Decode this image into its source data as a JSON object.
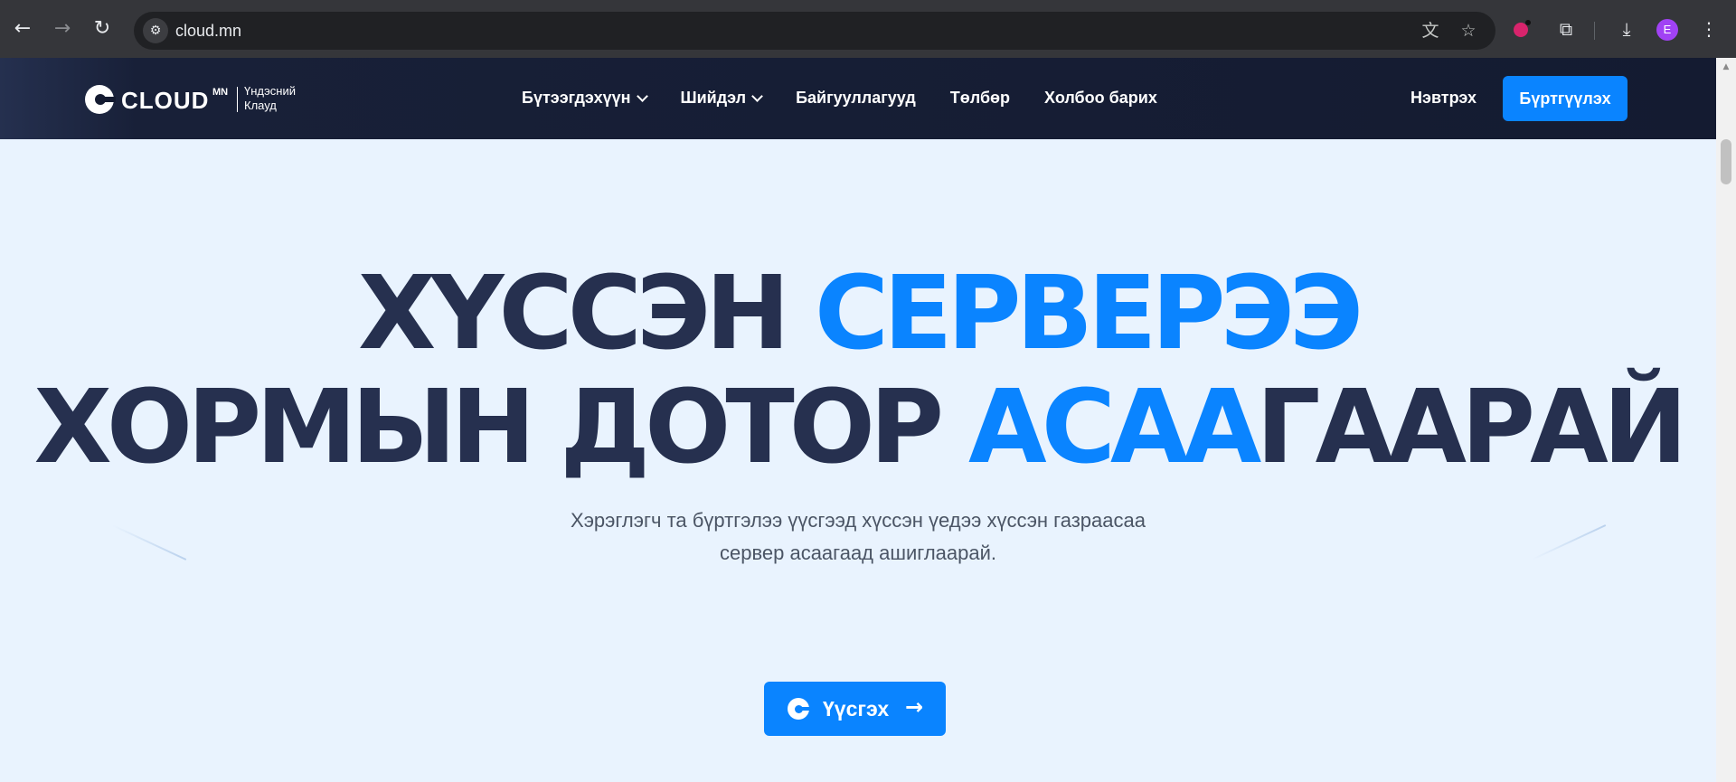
{
  "browser": {
    "url": "cloud.mn",
    "back_icon": "←",
    "forward_icon": "→",
    "reload_icon": "↻",
    "site_info_icon": "⚙",
    "translate_icon": "文",
    "bookmark_icon": "☆",
    "extensions_icon": "⧉",
    "download_icon": "⤓",
    "menu_icon": "⋮",
    "profile_initial": "E"
  },
  "header": {
    "logo_word": "CLOUD",
    "logo_sup": "MN",
    "logo_sub_1": "Үндэсний",
    "logo_sub_2": "Клауд",
    "menu": [
      {
        "label": "Бүтээгдэхүүн"
      },
      {
        "label": "Шийдэл"
      },
      {
        "label": "Байгууллагууд"
      },
      {
        "label": "Төлбөр"
      },
      {
        "label": "Холбоо барих"
      }
    ],
    "login": "Нэвтрэх",
    "signup": "Бүртгүүлэх"
  },
  "hero": {
    "line1_a": "ХҮССЭН ",
    "line1_b": "СЕРВЕРЭЭ",
    "line2_a": "ХОРМЫН ДОТОР ",
    "line2_b": "АСАА",
    "line2_c": "ГААРАЙ",
    "subtitle_1": "Хэрэглэгч та бүртгэлээ үүсгээд хүссэн үедээ хүссэн газраасаа",
    "subtitle_2": "сервер асаагаад ашиглаарай.",
    "cta": "Үүсгэх",
    "cta_arrow": "→"
  },
  "colors": {
    "accent": "#0a84ff",
    "heading": "#26304f",
    "nav_bg": "#141b31",
    "hero_bg": "#e9f3fe"
  }
}
